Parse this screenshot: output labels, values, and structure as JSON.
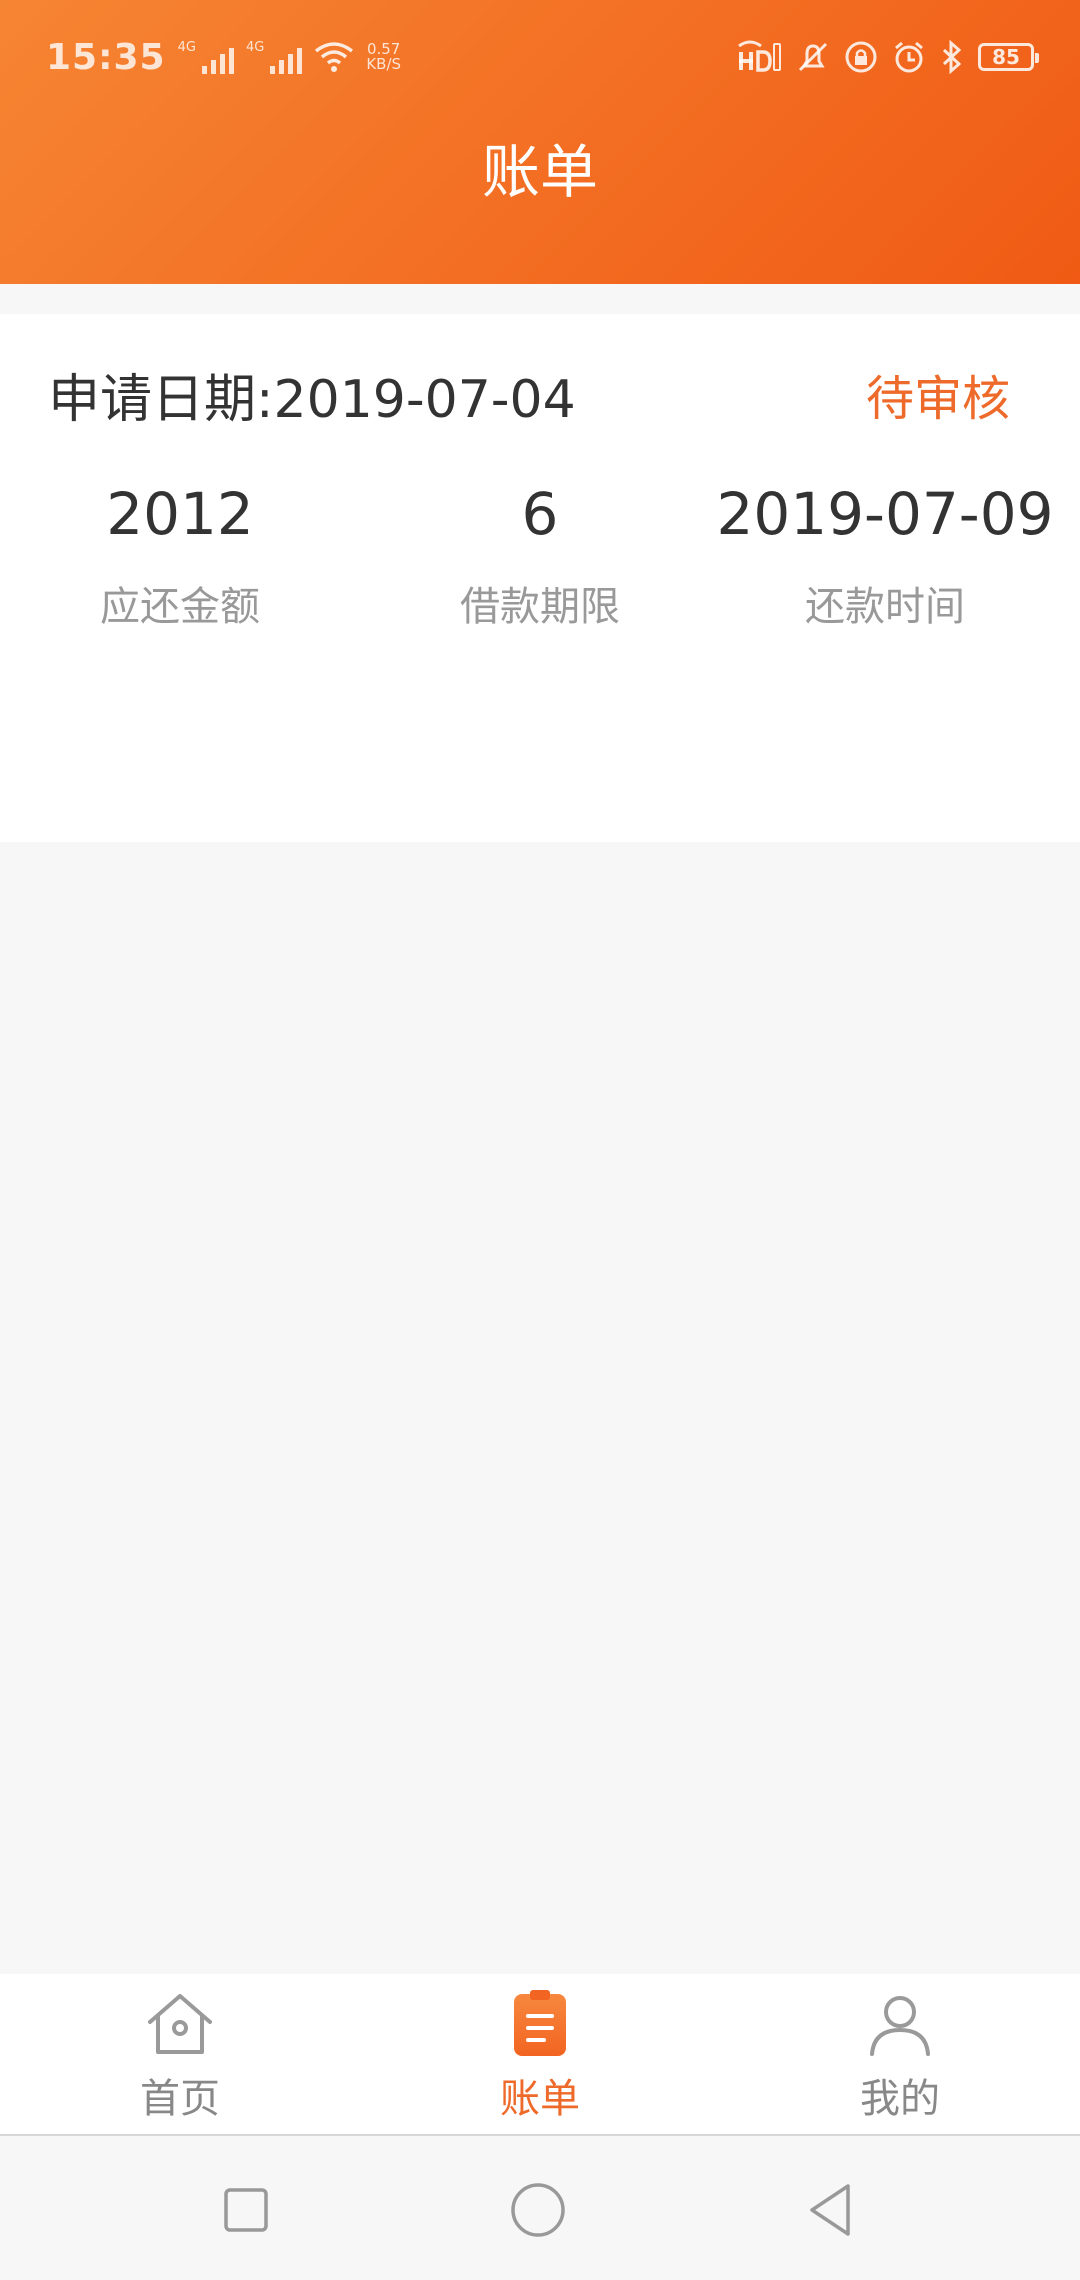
{
  "status_bar": {
    "time": "15:35",
    "network_1": "4G",
    "network_2": "4G",
    "speed_value": "0.57",
    "speed_unit": "KB/S",
    "battery": "85"
  },
  "header": {
    "title": "账单"
  },
  "bill": {
    "apply_date": "申请日期:2019-07-04",
    "status": "待审核",
    "stats": [
      {
        "value": "2012",
        "label": "应还金额"
      },
      {
        "value": "6",
        "label": "借款期限"
      },
      {
        "value": "2019-07-09",
        "label": "还款时间"
      }
    ]
  },
  "tabbar": {
    "tabs": [
      {
        "label": "首页",
        "icon": "home-icon",
        "active": false
      },
      {
        "label": "账单",
        "icon": "bill-icon",
        "active": true
      },
      {
        "label": "我的",
        "icon": "user-icon",
        "active": false
      }
    ]
  },
  "colors": {
    "header_start": "#f68533",
    "header_end": "#f05a14",
    "accent": "#ee6a2a"
  }
}
